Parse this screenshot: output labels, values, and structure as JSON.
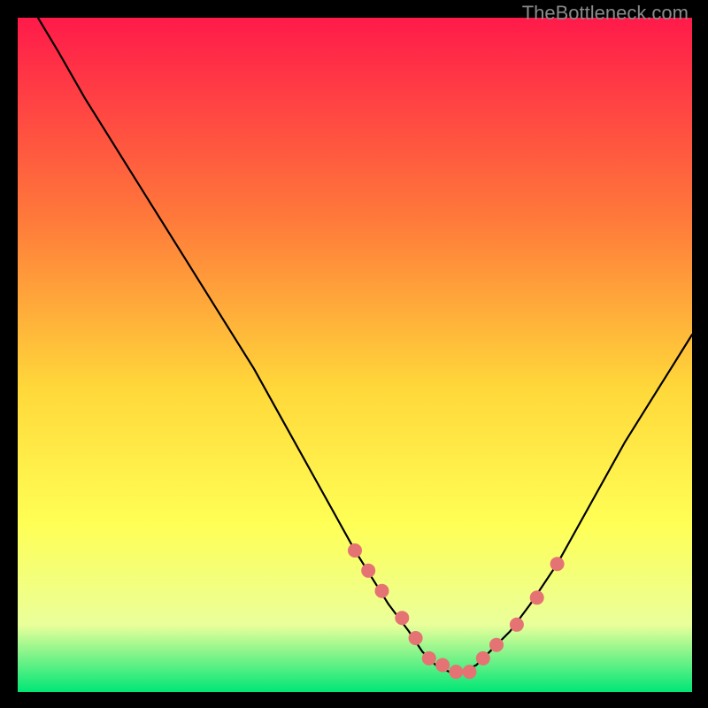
{
  "watermark": "TheBottleneck.com",
  "colors": {
    "gradient_top": "#ff1a4a",
    "gradient_mid1": "#ff7a3a",
    "gradient_mid2": "#ffd83a",
    "gradient_mid3": "#ffff55",
    "gradient_mid4": "#eaff9a",
    "gradient_bottom": "#00e676",
    "curve": "#000000",
    "marker_fill": "#e57373",
    "marker_stroke": "#c94f4f",
    "frame_bg": "#000000"
  },
  "chart_data": {
    "type": "line",
    "title": "",
    "xlabel": "",
    "ylabel": "",
    "xlim": [
      0,
      100
    ],
    "ylim": [
      0,
      100
    ],
    "curve": {
      "x": [
        3,
        6,
        10,
        15,
        20,
        25,
        30,
        35,
        40,
        45,
        50,
        55,
        58,
        60,
        62,
        64,
        66,
        68,
        70,
        73,
        76,
        80,
        85,
        90,
        95,
        100
      ],
      "y": [
        100,
        95,
        88,
        80,
        72,
        64,
        56,
        48,
        39,
        30,
        21,
        13,
        9,
        6,
        4,
        3,
        3,
        4,
        6,
        9,
        13,
        19,
        28,
        37,
        45,
        53
      ]
    },
    "markers": {
      "x": [
        50,
        52,
        54,
        57,
        59,
        61,
        63,
        65,
        67,
        69,
        71,
        74,
        77,
        80
      ],
      "y": [
        21,
        18,
        15,
        11,
        8,
        5,
        4,
        3,
        3,
        5,
        7,
        10,
        14,
        19
      ]
    }
  }
}
